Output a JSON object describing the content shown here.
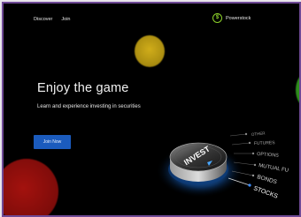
{
  "nav": {
    "discover": "Discover",
    "join": "Join"
  },
  "brand": {
    "name": "Powerstock",
    "logo_glyph": "$"
  },
  "hero": {
    "title": "Enjoy the game",
    "subtitle": "Learn and experience investing in securities",
    "cta": "Join Now"
  },
  "dial": {
    "knob_label": "INVEST",
    "options": [
      "OTHER",
      "FUTURES",
      "OPTIONS",
      "MUTUAL FU",
      "BONDS",
      "STOCKS"
    ]
  },
  "colors": {
    "background": "#000000",
    "frame_border": "#6f4a96",
    "cta": "#1b5bbd",
    "yellow_blob": "#c8a617",
    "green_blob": "#2e8d1c",
    "red_blob": "#9a110d",
    "brand_accent": "#8cd12a"
  }
}
